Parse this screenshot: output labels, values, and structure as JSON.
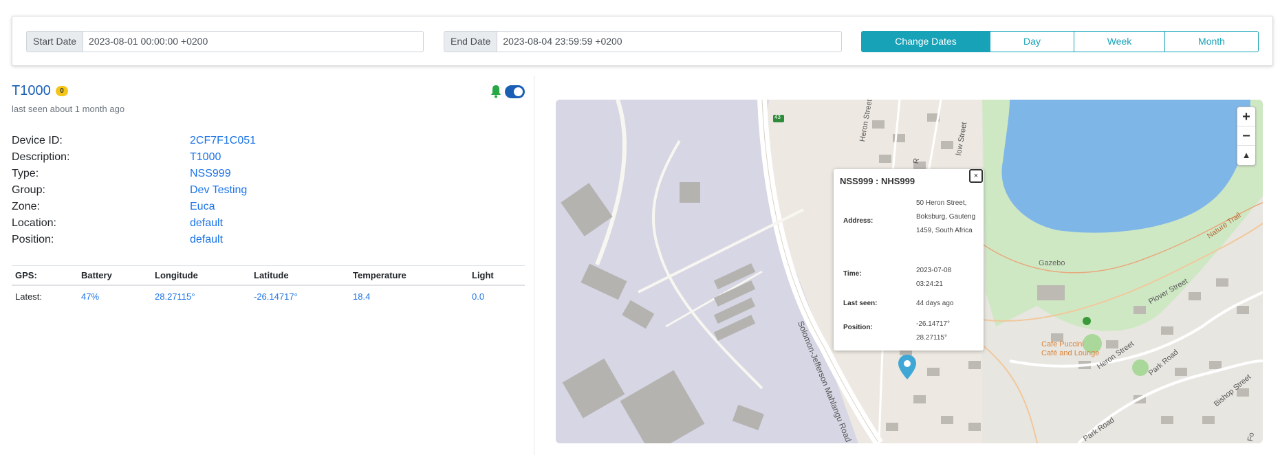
{
  "dates": {
    "start_label": "Start Date",
    "start_value": "2023-08-01 00:00:00 +0200",
    "end_label": "End Date",
    "end_value": "2023-08-04 23:59:59 +0200",
    "buttons": [
      "Change Dates",
      "Day",
      "Week",
      "Month"
    ]
  },
  "device": {
    "name": "T1000",
    "badge": "0",
    "last_seen": "last seen about 1 month ago",
    "properties": [
      {
        "key": "Device ID:",
        "value": "2CF7F1C051"
      },
      {
        "key": "Description:",
        "value": "T1000"
      },
      {
        "key": "Type:",
        "value": "NSS999"
      },
      {
        "key": "Group:",
        "value": "Dev Testing"
      },
      {
        "key": "Zone:",
        "value": "Euca"
      },
      {
        "key": "Location:",
        "value": "default"
      },
      {
        "key": "Position:",
        "value": "default"
      }
    ]
  },
  "gps_table": {
    "headers": [
      "GPS:",
      "Battery",
      "Longitude",
      "Latitude",
      "Temperature",
      "Light"
    ],
    "row": [
      "Latest:",
      "47%",
      "28.27115°",
      "-26.14717°",
      "18.4",
      "0.0"
    ]
  },
  "map": {
    "zoom_in": "+",
    "zoom_out": "−",
    "reset": "▲",
    "road_badge": "43",
    "labels": {
      "gazebo": "Gazebo",
      "cafe_line1": "Cafe Puccini",
      "cafe_line2": "Café and Lounge",
      "heron1": "Heron Street",
      "heron2": "Heron Street",
      "plover": "Plover Street",
      "park1": "Park Road",
      "park2": "Park Road",
      "bishop": "Bishop Street",
      "nature": "Nature Trail",
      "solomon": "Solomon-Jefferson Mahlangu Road",
      "low": "low Street",
      "r": "R",
      "f": "Fo"
    },
    "popup": {
      "title": "NSS999 : NHS999",
      "close": "×",
      "address_label": "Address:",
      "address_value": "50 Heron Street, Boksburg, Gauteng 1459, South Africa",
      "time_label": "Time:",
      "time_value": "2023-07-08 03:24:21",
      "lastseen_label": "Last seen:",
      "lastseen_value": "44 days ago",
      "position_label": "Position:",
      "position_value": "-26.14717° 28.27115°"
    }
  },
  "colors": {
    "accent": "#17a2b8",
    "link": "#1a73e8",
    "toggle": "#1a5fb4",
    "bell": "#28a745",
    "badge": "#f5c518"
  }
}
